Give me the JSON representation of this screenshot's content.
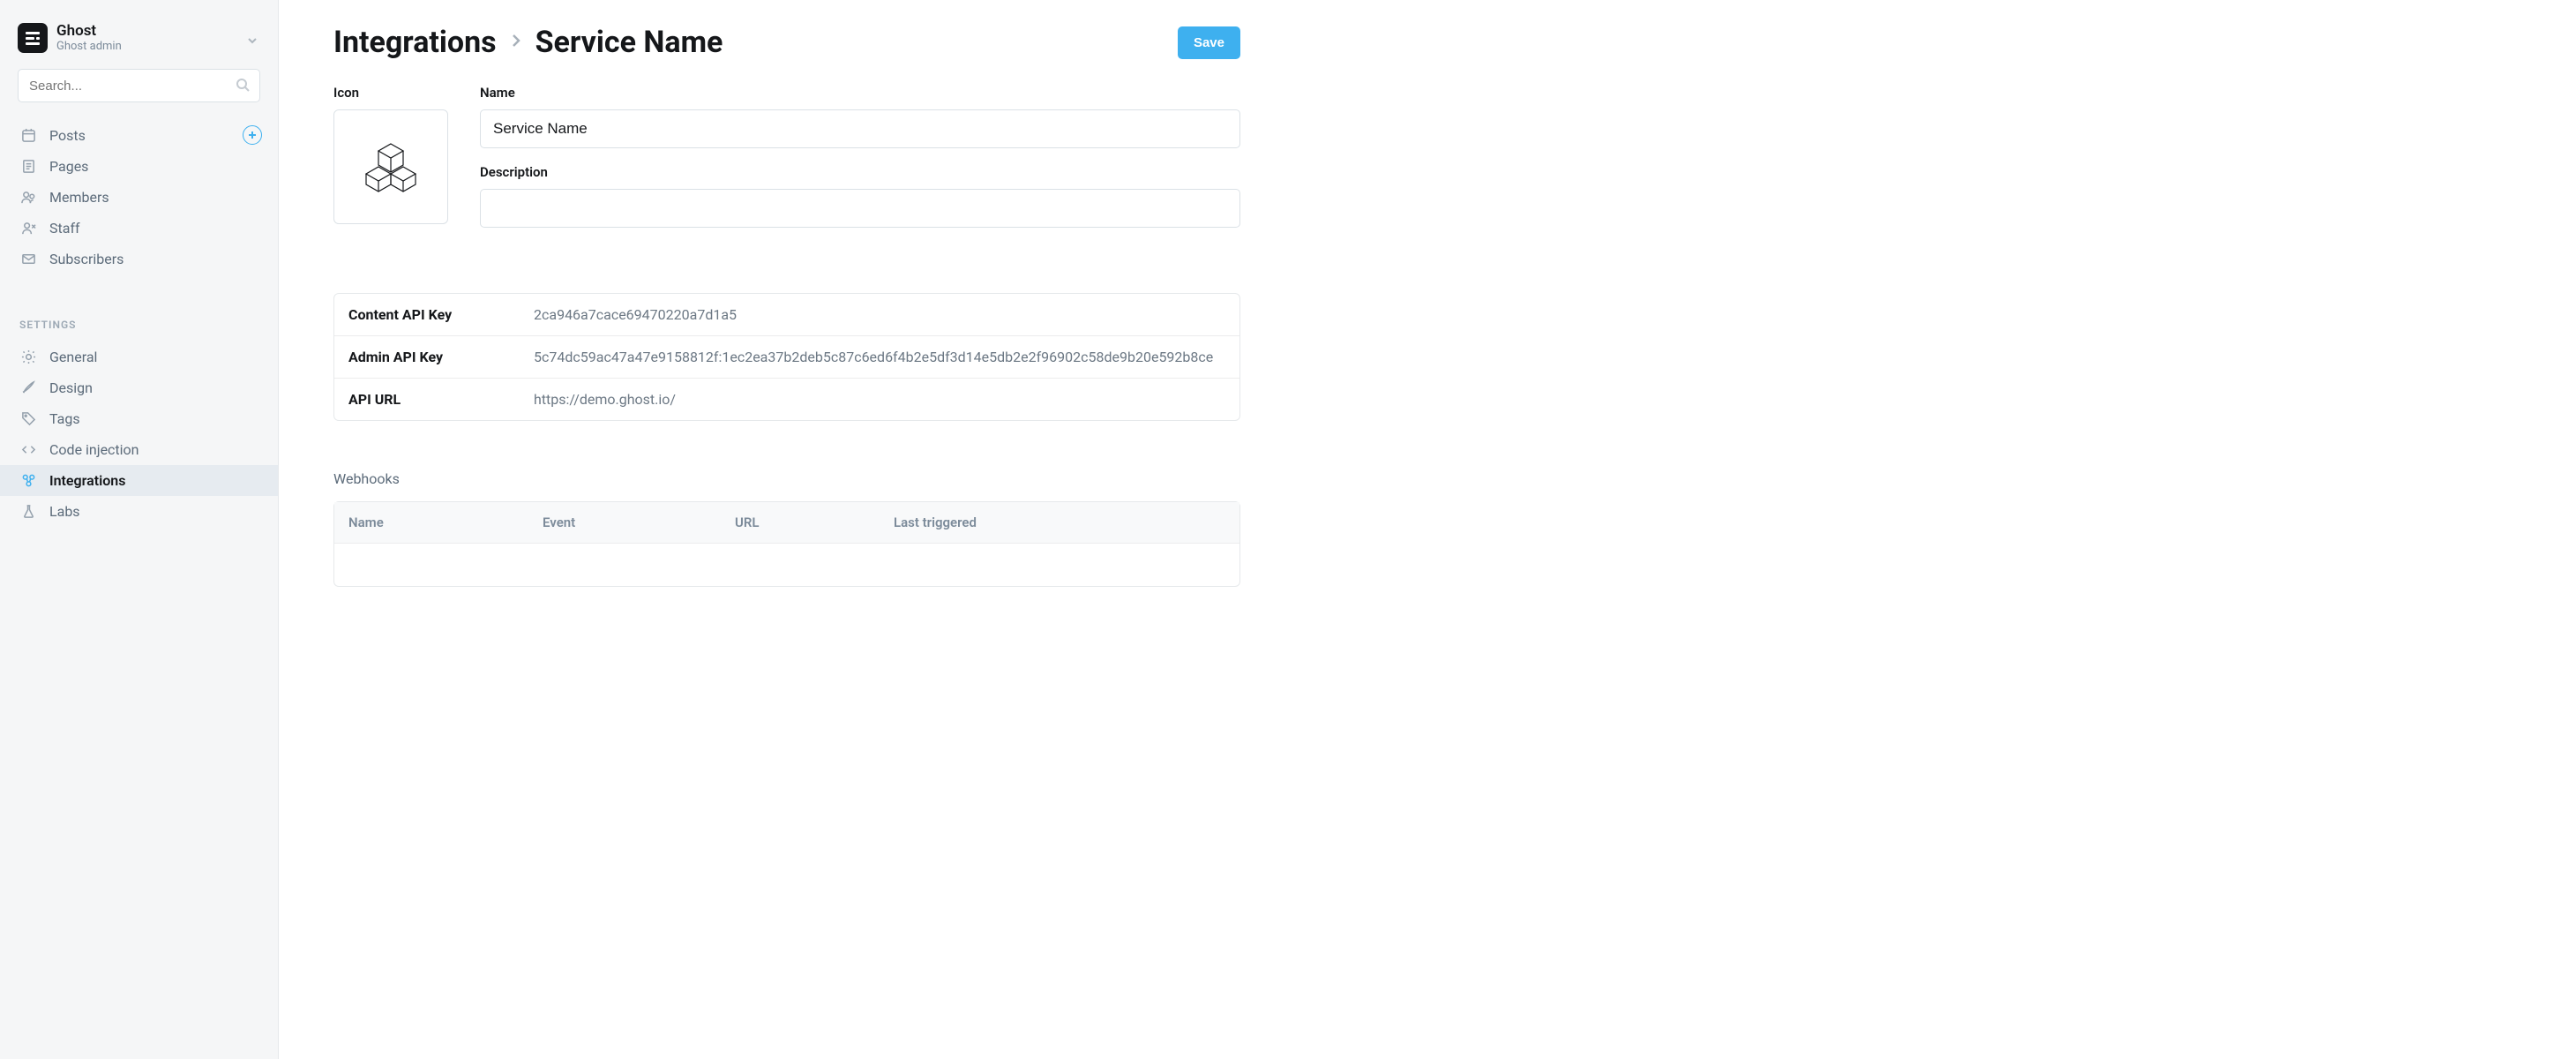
{
  "brand": {
    "title": "Ghost",
    "sub": "Ghost admin"
  },
  "search": {
    "placeholder": "Search..."
  },
  "nav_main": [
    {
      "label": "Posts"
    },
    {
      "label": "Pages"
    },
    {
      "label": "Members"
    },
    {
      "label": "Staff"
    },
    {
      "label": "Subscribers"
    }
  ],
  "settings_label": "SETTINGS",
  "nav_settings": [
    {
      "label": "General"
    },
    {
      "label": "Design"
    },
    {
      "label": "Tags"
    },
    {
      "label": "Code injection"
    },
    {
      "label": "Integrations"
    },
    {
      "label": "Labs"
    }
  ],
  "breadcrumb": {
    "root": "Integrations",
    "leaf": "Service Name"
  },
  "save_label": "Save",
  "form": {
    "icon_label": "Icon",
    "name_label": "Name",
    "name_value": "Service Name",
    "desc_label": "Description",
    "desc_value": ""
  },
  "api": {
    "rows": [
      {
        "k": "Content API Key",
        "v": "2ca946a7cace69470220a7d1a5"
      },
      {
        "k": "Admin API Key",
        "v": "5c74dc59ac47a47e9158812f:1ec2ea37b2deb5c87c6ed6f4b2e5df3d14e5db2e2f96902c58de9b20e592b8ce"
      },
      {
        "k": "API URL",
        "v": "https://demo.ghost.io/"
      }
    ]
  },
  "webhooks": {
    "title": "Webhooks",
    "cols": {
      "name": "Name",
      "event": "Event",
      "url": "URL",
      "last": "Last triggered"
    }
  }
}
